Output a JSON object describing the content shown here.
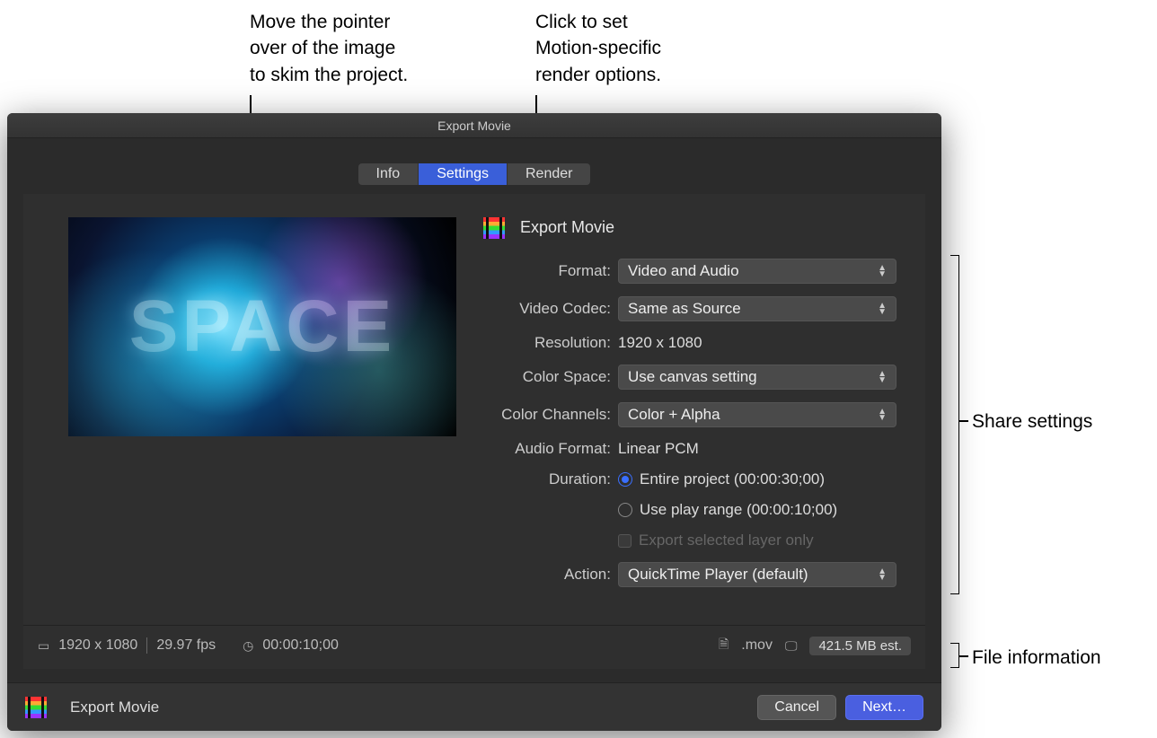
{
  "callouts": {
    "skim": "Move the pointer\nover of the image\nto skim the project.",
    "render": "Click to set\nMotion-specific\nrender options.",
    "share": "Share settings",
    "fileinfo": "File information"
  },
  "titlebar": "Export Movie",
  "tabs": {
    "info": "Info",
    "settings": "Settings",
    "render": "Render"
  },
  "preview_text": "SPACE",
  "section_title": "Export Movie",
  "fields": {
    "format": {
      "label": "Format:",
      "value": "Video and Audio"
    },
    "video_codec": {
      "label": "Video Codec:",
      "value": "Same as Source"
    },
    "resolution": {
      "label": "Resolution:",
      "value": "1920 x 1080"
    },
    "color_space": {
      "label": "Color Space:",
      "value": "Use canvas setting"
    },
    "color_channels": {
      "label": "Color Channels:",
      "value": "Color + Alpha"
    },
    "audio_format": {
      "label": "Audio Format:",
      "value": "Linear PCM"
    },
    "duration": {
      "label": "Duration:",
      "opt_entire": "Entire project (00:00:30;00)",
      "opt_range": "Use play range (00:00:10;00)"
    },
    "export_layer": "Export selected layer only",
    "action": {
      "label": "Action:",
      "value": "QuickTime Player (default)"
    }
  },
  "footer": {
    "dims": "1920 x 1080",
    "fps": "29.97 fps",
    "time": "00:00:10;00",
    "ext": ".mov",
    "size": "421.5 MB est."
  },
  "actionbar": {
    "title": "Export Movie",
    "cancel": "Cancel",
    "next": "Next…"
  }
}
